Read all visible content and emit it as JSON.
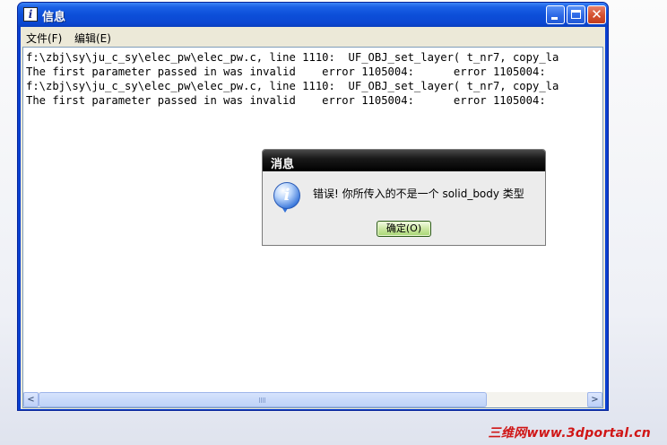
{
  "window": {
    "title": "信息",
    "icon": "info-i-icon"
  },
  "menu": {
    "items": [
      {
        "label": "文件(F)"
      },
      {
        "label": "编辑(E)"
      }
    ]
  },
  "log": {
    "lines": [
      "f:\\zbj\\sy\\ju_c_sy\\elec_pw\\elec_pw.c, line 1110:  UF_OBJ_set_layer( t_nr7, copy_la",
      "The first parameter passed in was invalid    error 1105004:      error 1105004:",
      "f:\\zbj\\sy\\ju_c_sy\\elec_pw\\elec_pw.c, line 1110:  UF_OBJ_set_layer( t_nr7, copy_la",
      "The first parameter passed in was invalid    error 1105004:      error 1105004:"
    ]
  },
  "scrollbar": {
    "left_arrow": "<",
    "right_arrow": ">"
  },
  "dialog": {
    "title": "消息",
    "message": "错误! 你所传入的不是一个 solid_body 类型",
    "ok_label": "确定(O)",
    "icon": "information-icon"
  },
  "watermark": {
    "text": "三维网www.3dportal.cn"
  },
  "colors": {
    "titlebar": "#0b47d2",
    "dialog_title": "#000000",
    "ok_button": "#cfe9a8",
    "watermark": "#d01616"
  }
}
